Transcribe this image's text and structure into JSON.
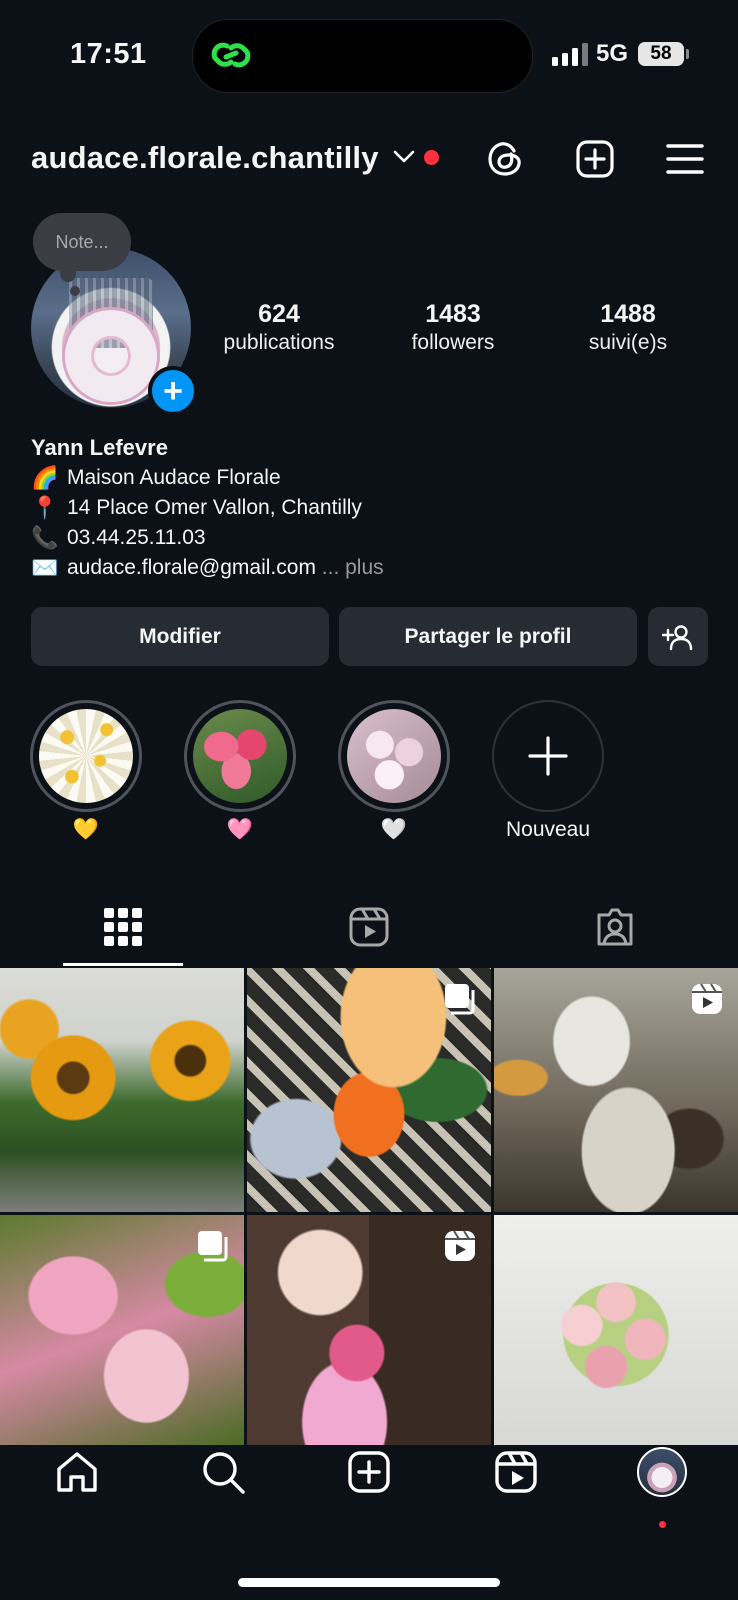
{
  "status_bar": {
    "time": "17:51",
    "network": "5G",
    "battery": "58"
  },
  "header": {
    "username": "audace.florale.chantilly",
    "icons": [
      "chevron-down-icon",
      "threads-icon",
      "create-icon",
      "menu-icon"
    ]
  },
  "profile": {
    "note_placeholder": "Note...",
    "stats": [
      {
        "value": "624",
        "label": "publications"
      },
      {
        "value": "1483",
        "label": "followers"
      },
      {
        "value": "1488",
        "label": "suivi(e)s"
      }
    ],
    "name": "Yann Lefevre",
    "bio": [
      {
        "emoji": "🌈",
        "text": "Maison Audace Florale"
      },
      {
        "emoji": "📍",
        "text": "14 Place Omer Vallon, Chantilly"
      },
      {
        "emoji": "📞",
        "text": "03.44.25.11.03"
      },
      {
        "emoji": "✉️",
        "text": "audace.florale@gmail.com"
      }
    ],
    "more_text": "... plus"
  },
  "actions": {
    "edit": "Modifier",
    "share": "Partager le profil"
  },
  "highlights": [
    {
      "caption": "💛"
    },
    {
      "caption": "🩷"
    },
    {
      "caption": "🤍"
    },
    {
      "caption": "Nouveau"
    }
  ],
  "tabs": [
    "grid-tab",
    "reels-tab",
    "tagged-tab"
  ],
  "posts": [
    {
      "type": "photo"
    },
    {
      "type": "carousel"
    },
    {
      "type": "reel"
    },
    {
      "type": "carousel"
    },
    {
      "type": "reel"
    },
    {
      "type": "photo"
    }
  ],
  "colors": {
    "background": "#0c1017",
    "accent": "#0095f6",
    "notification": "#ff3040",
    "button": "#272b33"
  }
}
